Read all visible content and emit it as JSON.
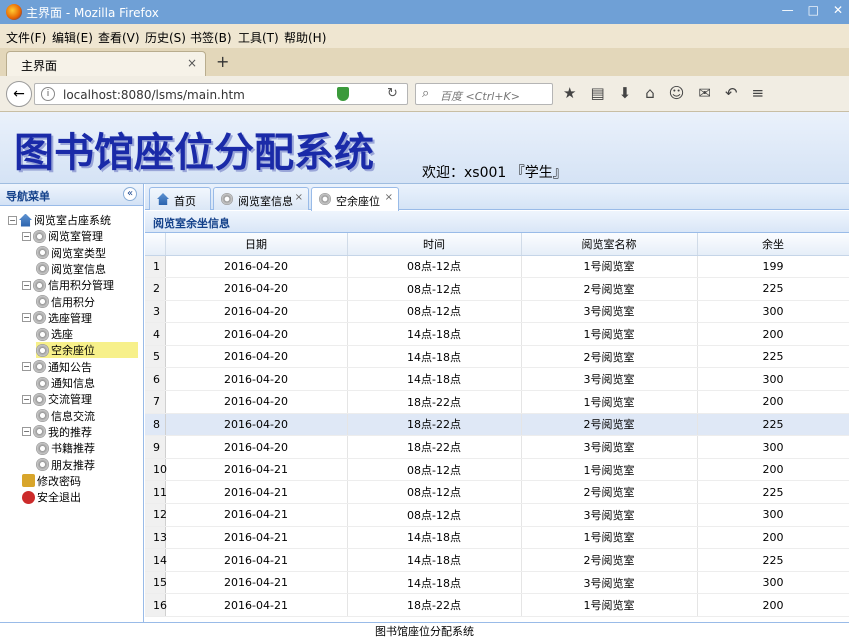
{
  "browser": {
    "window_title": "主界面 - Mozilla Firefox",
    "window_controls": [
      "—",
      "□",
      "✕"
    ],
    "menu": [
      "文件(F)",
      "编辑(E)",
      "查看(V)",
      "历史(S)",
      "书签(B)",
      "工具(T)",
      "帮助(H)"
    ],
    "tab_title": "主界面",
    "tab_close": "×",
    "new_tab": "+",
    "back": "←",
    "url": "localhost:8080/lsms/main.htm",
    "search_placeholder": "百度 <Ctrl+K>",
    "toolbar_icons": [
      "★",
      "▤",
      "⬇",
      "⌂",
      "☺",
      "✉",
      "↶",
      "≡"
    ]
  },
  "app": {
    "logo": "图书馆座位分配系统",
    "welcome": "欢迎：xs001 『学生』"
  },
  "sidebar": {
    "title": "导航菜单",
    "collapse": "«",
    "items": [
      {
        "label": "阅览室占座系统",
        "icon": "home-icon",
        "toggle": "−"
      },
      {
        "label": "阅览室管理",
        "icon": "gear-icon",
        "toggle": "−"
      },
      {
        "label": "阅览室类型",
        "icon": "gear-icon",
        "toggle": ""
      },
      {
        "label": "阅览室信息",
        "icon": "gear-icon",
        "toggle": ""
      },
      {
        "label": "信用积分管理",
        "icon": "gear-icon",
        "toggle": "−"
      },
      {
        "label": "信用积分",
        "icon": "gear-icon",
        "toggle": ""
      },
      {
        "label": "选座管理",
        "icon": "gear-icon",
        "toggle": "−"
      },
      {
        "label": "选座",
        "icon": "gear-icon",
        "toggle": ""
      },
      {
        "label": "空余座位",
        "icon": "gear-icon",
        "toggle": ""
      },
      {
        "label": "通知公告",
        "icon": "gear-icon",
        "toggle": "−"
      },
      {
        "label": "通知信息",
        "icon": "gear-icon",
        "toggle": ""
      },
      {
        "label": "交流管理",
        "icon": "gear-icon",
        "toggle": "−"
      },
      {
        "label": "信息交流",
        "icon": "gear-icon",
        "toggle": ""
      },
      {
        "label": "我的推荐",
        "icon": "gear-icon",
        "toggle": "−"
      },
      {
        "label": "书籍推荐",
        "icon": "gear-icon",
        "toggle": ""
      },
      {
        "label": "朋友推荐",
        "icon": "gear-icon",
        "toggle": ""
      },
      {
        "label": "修改密码",
        "icon": "key-icon",
        "toggle": ""
      },
      {
        "label": "安全退出",
        "icon": "exit-icon",
        "toggle": ""
      }
    ],
    "selected": "空余座位"
  },
  "tabs": [
    {
      "label": "首页",
      "icon": "home-icon",
      "close": ""
    },
    {
      "label": "阅览室信息",
      "icon": "gear-icon",
      "close": "×"
    },
    {
      "label": "空余座位",
      "icon": "gear-icon",
      "close": "×"
    }
  ],
  "panel_title": "阅览室余坐信息",
  "table": {
    "columns": [
      "",
      "日期",
      "时间",
      "阅览室名称",
      "余坐"
    ],
    "rows": [
      [
        "1",
        "2016-04-20",
        "08点-12点",
        "1号阅览室",
        "199"
      ],
      [
        "2",
        "2016-04-20",
        "08点-12点",
        "2号阅览室",
        "225"
      ],
      [
        "3",
        "2016-04-20",
        "08点-12点",
        "3号阅览室",
        "300"
      ],
      [
        "4",
        "2016-04-20",
        "14点-18点",
        "1号阅览室",
        "200"
      ],
      [
        "5",
        "2016-04-20",
        "14点-18点",
        "2号阅览室",
        "225"
      ],
      [
        "6",
        "2016-04-20",
        "14点-18点",
        "3号阅览室",
        "300"
      ],
      [
        "7",
        "2016-04-20",
        "18点-22点",
        "1号阅览室",
        "200"
      ],
      [
        "8",
        "2016-04-20",
        "18点-22点",
        "2号阅览室",
        "225"
      ],
      [
        "9",
        "2016-04-20",
        "18点-22点",
        "3号阅览室",
        "300"
      ],
      [
        "10",
        "2016-04-21",
        "08点-12点",
        "1号阅览室",
        "200"
      ],
      [
        "11",
        "2016-04-21",
        "08点-12点",
        "2号阅览室",
        "225"
      ],
      [
        "12",
        "2016-04-21",
        "08点-12点",
        "3号阅览室",
        "300"
      ],
      [
        "13",
        "2016-04-21",
        "14点-18点",
        "1号阅览室",
        "200"
      ],
      [
        "14",
        "2016-04-21",
        "14点-18点",
        "2号阅览室",
        "225"
      ],
      [
        "15",
        "2016-04-21",
        "14点-18点",
        "3号阅览室",
        "300"
      ],
      [
        "16",
        "2016-04-21",
        "18点-22点",
        "1号阅览室",
        "200"
      ]
    ],
    "highlight_row": 8
  },
  "footer": "图书馆座位分配系统"
}
